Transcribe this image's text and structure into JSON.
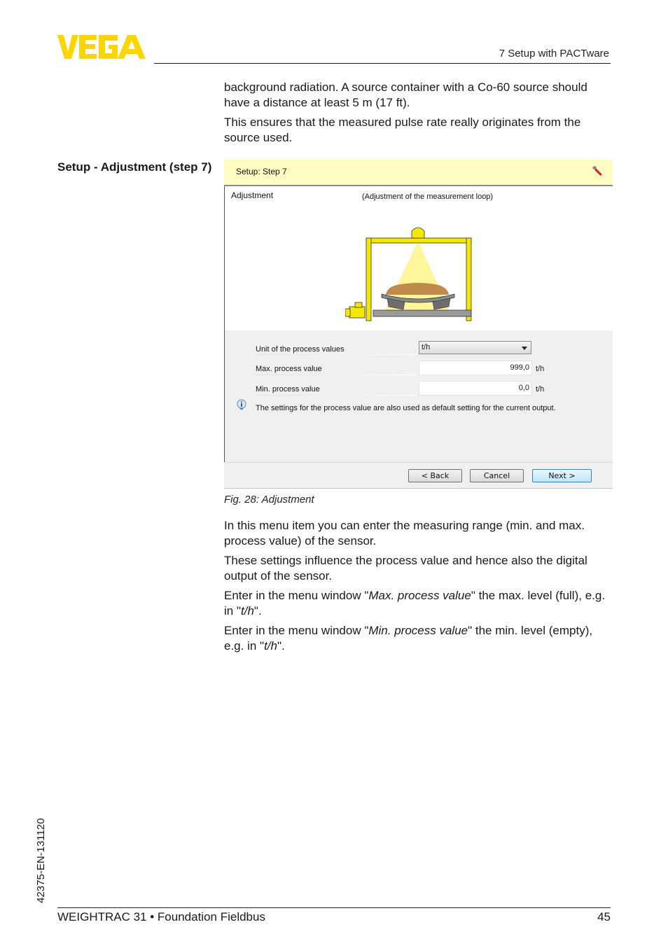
{
  "header": {
    "brand": "VEGA",
    "brand_color": "#ffd500",
    "section": "7 Setup with PACTware"
  },
  "intro": {
    "paragraphs": [
      "background radiation. A source container with a Co-60 source should have a distance at least 5 m (17 ft).",
      "This ensures that the measured pulse rate really originates from the source used."
    ]
  },
  "side_heading": "Setup - Adjustment (step 7)",
  "dialog": {
    "title": "Setup: Step 7",
    "title_icon": "wrench-icon",
    "title_bg": "#fdfdc3",
    "section_label": "Adjustment",
    "section_subtitle": "(Adjustment of the measurement loop)",
    "illustration": "belt-weigher-illustration",
    "fields": {
      "unit": {
        "label": "Unit of the process values",
        "value": "t/h"
      },
      "max": {
        "label": "Max. process value",
        "value": "999,0",
        "unit": "t/h"
      },
      "min": {
        "label": "Min. process value",
        "value": "0,0",
        "unit": "t/h"
      }
    },
    "info_text": "The settings for the process value are also used as default setting for the current output.",
    "buttons": {
      "back": "< Back",
      "cancel": "Cancel",
      "next": "Next >"
    }
  },
  "caption": "Fig. 28: Adjustment",
  "body": {
    "p1": "In this menu item you can enter the measuring range (min. and max. process value) of the sensor.",
    "p2": "These settings influence the process value and hence also the digital output of the sensor.",
    "p3": {
      "a": "Enter in the menu window \"",
      "em1": "Max. process value",
      "b": "\" the max. level (full), e.g. in \"",
      "em2": "t/h",
      "c": "\"."
    },
    "p4": {
      "a": "Enter in the menu window \"",
      "em1": "Min. process value",
      "b": "\" the min. level (empty), e.g. in \"",
      "em2": "t/h",
      "c": "\"."
    }
  },
  "footer": {
    "title": "WEIGHTRAC 31 • Foundation Fieldbus",
    "page": "45",
    "doc_code": "42375-EN-131120"
  }
}
